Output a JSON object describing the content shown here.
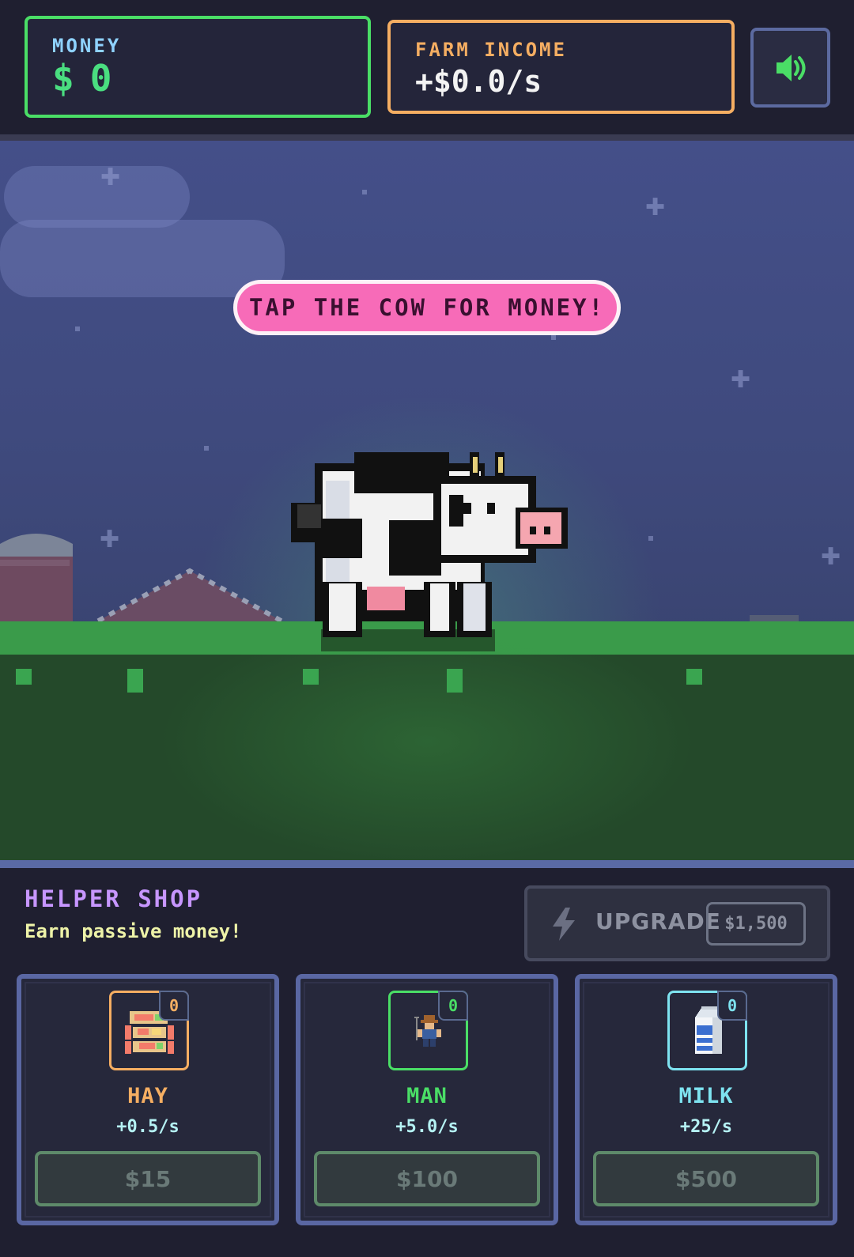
{
  "header": {
    "money_label": "MONEY",
    "money_currency": "$",
    "money_value": "0",
    "income_label": "FARM INCOME",
    "income_value": "+$0.0/s",
    "sound_icon": "speaker-icon"
  },
  "scene": {
    "banner": "TAP THE COW FOR MONEY!"
  },
  "shop": {
    "title": "HELPER SHOP",
    "subtitle": "Earn passive money!",
    "upgrade_label": "UPGRADE",
    "upgrade_price": "$1,500",
    "items": [
      {
        "name": "HAY",
        "count": "0",
        "rate": "+0.5/s",
        "price": "$15",
        "color": "#f5ae62",
        "icon": "hay-bale-icon"
      },
      {
        "name": "MAN",
        "count": "0",
        "rate": "+5.0/s",
        "price": "$100",
        "color": "#4ade66",
        "icon": "farmer-icon"
      },
      {
        "name": "MILK",
        "count": "0",
        "rate": "+25/s",
        "price": "$500",
        "color": "#7ee3f0",
        "icon": "milk-carton-icon"
      }
    ]
  },
  "colors": {
    "money_accent": "#4ade66",
    "income_accent": "#f5ae62",
    "banner_pink": "#f76bb8",
    "shop_title": "#c796ff"
  }
}
